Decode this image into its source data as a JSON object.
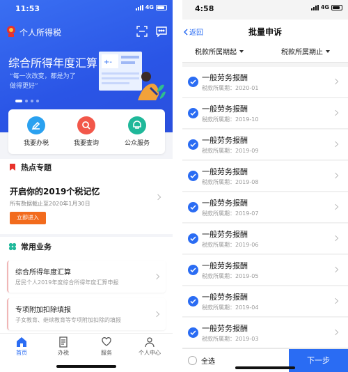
{
  "left": {
    "status_time": "11:53",
    "network": "4G",
    "app_title": "个人所得税",
    "banner": {
      "title": "综合所得年度汇算",
      "subtitle": "“每一次改变，都是为了做得更好”"
    },
    "quick": [
      {
        "label": "我要办税",
        "color": "#2aa1f0"
      },
      {
        "label": "我要查询",
        "color": "#f2574a"
      },
      {
        "label": "公众服务",
        "color": "#1fb89a"
      }
    ],
    "hot": {
      "heading": "热点专题",
      "title": "开启你的2019个税记忆",
      "subtitle": "所有数据截止至2020年1月30日",
      "button": "立即进入"
    },
    "common": {
      "heading": "常用业务",
      "items": [
        {
          "title": "综合所得年度汇算",
          "subtitle": "居民个人2019年度综合所得年度汇算申报"
        },
        {
          "title": "专项附加扣除填报",
          "subtitle": "子女教育、继续教育等专项附加扣除的填报"
        }
      ]
    },
    "tabs": [
      {
        "label": "首页"
      },
      {
        "label": "办税"
      },
      {
        "label": "服务"
      },
      {
        "label": "个人中心"
      }
    ],
    "accent": "#2a6cf3"
  },
  "right": {
    "status_time": "4:58",
    "network": "4G",
    "back_label": "返回",
    "title": "批量申诉",
    "filter_start": "税款所属期起",
    "filter_end": "税款所属期止",
    "rows": [
      {
        "title": "一般劳务报酬",
        "subtitle": "税款所属期：2020-01"
      },
      {
        "title": "一般劳务报酬",
        "subtitle": "税款所属期：2019-10"
      },
      {
        "title": "一般劳务报酬",
        "subtitle": "税款所属期：2019-09"
      },
      {
        "title": "一般劳务报酬",
        "subtitle": "税款所属期：2019-08"
      },
      {
        "title": "一般劳务报酬",
        "subtitle": "税款所属期：2019-07"
      },
      {
        "title": "一般劳务报酬",
        "subtitle": "税款所属期：2019-06"
      },
      {
        "title": "一般劳务报酬",
        "subtitle": "税款所属期：2019-05"
      },
      {
        "title": "一般劳务报酬",
        "subtitle": "税款所属期：2019-04"
      },
      {
        "title": "一般劳务报酬",
        "subtitle": "税款所属期：2019-03"
      }
    ],
    "select_all": "全选",
    "next": "下一步"
  }
}
